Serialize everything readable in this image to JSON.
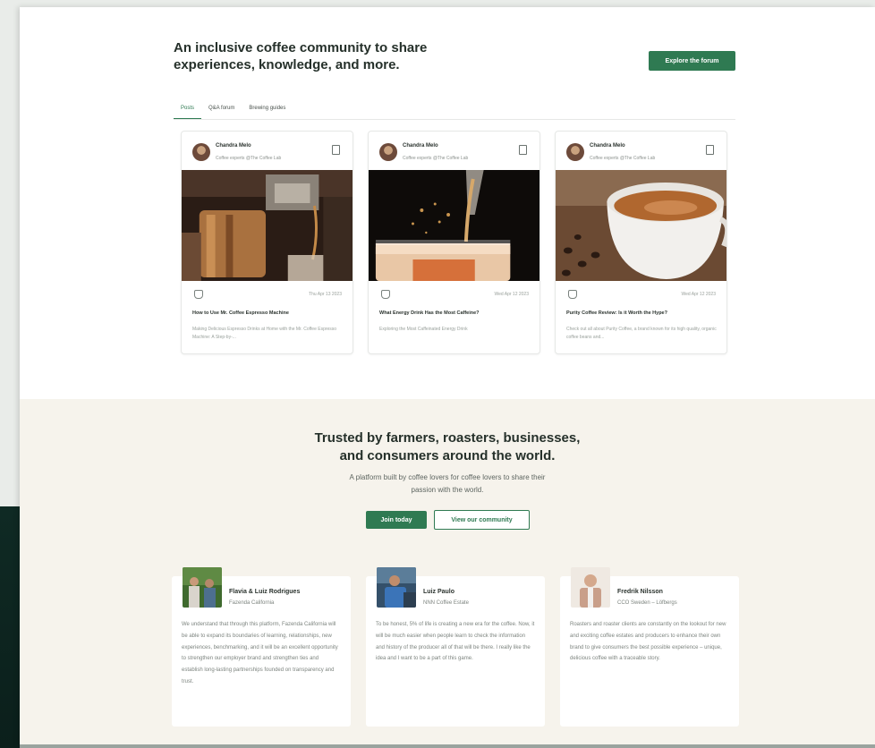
{
  "forum": {
    "headline": "An inclusive coffee community to share experiences, knowledge, and more.",
    "explore_label": "Explore the forum",
    "tabs": [
      {
        "label": "Posts",
        "active": true
      },
      {
        "label": "Q&A forum",
        "active": false
      },
      {
        "label": "Brewing guides",
        "active": false
      }
    ],
    "cards": [
      {
        "author": "Chandra Melo",
        "role": "Coffee experts @The Coffee Lab",
        "date": "Thu Apr 13 2023",
        "title": "How to Use Mr. Coffee Espresso Machine",
        "excerpt": "Making Delicious Espresso Drinks at Home with the Mr. Coffee Espresso Machine: A Step-by-...",
        "image": "espresso-machine-photo"
      },
      {
        "author": "Chandra Melo",
        "role": "Coffee experts @The Coffee Lab",
        "date": "Wed Apr 12 2023",
        "title": "What Energy Drink Has the Most Caffeine?",
        "excerpt": "Exploring the Most Caffeinated Energy Drink",
        "image": "iced-coffee-photo"
      },
      {
        "author": "Chandra Melo",
        "role": "Coffee experts @The Coffee Lab",
        "date": "Wed Apr 12 2023",
        "title": "Purity Coffee Review: Is it Worth the Hype?",
        "excerpt": "Check out all about Purity Coffee, a brand known for its high quality, organic coffee beans and...",
        "image": "coffee-cup-photo"
      }
    ]
  },
  "trust": {
    "title_line1": "Trusted by farmers, roasters, businesses,",
    "title_line2": "and consumers around the world.",
    "subtitle": "A platform built by coffee lovers for coffee lovers to share their passion with the world.",
    "join_label": "Join today",
    "community_label": "View our community",
    "testimonials": [
      {
        "name": "Flavia & Luiz Rodrigues",
        "org": "Fazenda California",
        "quote": "We understand that through this platform, Fazenda California will be able to expand its boundaries of learning, relationships, new experiences, benchmarking, and it will be an excellent opportunity to strengthen our employer brand and strengthen ties and establish long-lasting partnerships founded on transparency and trust."
      },
      {
        "name": "Luiz Paulo",
        "org": "NNN Coffee Estate",
        "quote": "To be honest, 5% of life is creating a new era for the coffee. Now, it will be much easier when people learn to check the information and history of the producer all of that will be there. I really like the idea and I want to be a part of this game."
      },
      {
        "name": "Fredrik Nilsson",
        "org": "CCO Sweden – Löfbergs",
        "quote": "Roasters and roaster clients are constantly on the lookout for new and exciting coffee estates and producers to enhance their own brand to give consumers the best possible experience – unique, delicious coffee with a traceable story."
      }
    ]
  },
  "colors": {
    "accent": "#2f7a52",
    "trust_bg": "#f6f3ec"
  }
}
